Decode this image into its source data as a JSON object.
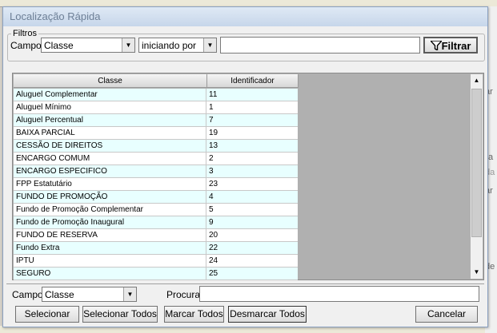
{
  "window": {
    "title": "Localização Rápida"
  },
  "filters": {
    "legend": "Filtros",
    "campo_label": "Campo:",
    "campo_value": "Classe",
    "operator_value": "iniciando por",
    "search_value": "",
    "filter_button": "Filtrar"
  },
  "grid": {
    "columns": [
      "Classe",
      "Identificador"
    ],
    "rows": [
      {
        "classe": "Aluguel Complementar",
        "id": "11"
      },
      {
        "classe": "Aluguel Mínimo",
        "id": "1"
      },
      {
        "classe": "Aluguel Percentual",
        "id": "7"
      },
      {
        "classe": "BAIXA PARCIAL",
        "id": "19"
      },
      {
        "classe": "CESSÃO DE DIREITOS",
        "id": "13"
      },
      {
        "classe": "ENCARGO COMUM",
        "id": "2"
      },
      {
        "classe": "ENCARGO ESPECIFICO",
        "id": "3"
      },
      {
        "classe": "FPP Estatutário",
        "id": "23"
      },
      {
        "classe": "FUNDO DE PROMOÇÃO",
        "id": "4"
      },
      {
        "classe": "Fundo de Promoção Complementar",
        "id": "5"
      },
      {
        "classe": "Fundo de Promoção Inaugural",
        "id": "9"
      },
      {
        "classe": "FUNDO DE RESERVA",
        "id": "20"
      },
      {
        "classe": "Fundo Extra",
        "id": "22"
      },
      {
        "classe": "IPTU",
        "id": "24"
      },
      {
        "classe": "SEGURO",
        "id": "25"
      }
    ]
  },
  "bottom": {
    "campo_label": "Campo:",
    "campo_value": "Classe",
    "procura_label": "Procura:",
    "procura_value": "",
    "buttons": {
      "selecionar": "Selecionar",
      "selecionar_todos": "Selecionar Todos",
      "marcar_todos": "Marcar Todos",
      "desmarcar_todos": "Desmarcar Todos",
      "cancelar": "Cancelar"
    }
  },
  "background": {
    "right_fragments": [
      "ar",
      "a",
      "da",
      "ar",
      "de"
    ]
  },
  "icons": {
    "filter": "funnel-icon",
    "dropdown": "chevron-down-icon",
    "scroll_up": "arrow-up-icon",
    "scroll_down": "arrow-down-icon"
  }
}
